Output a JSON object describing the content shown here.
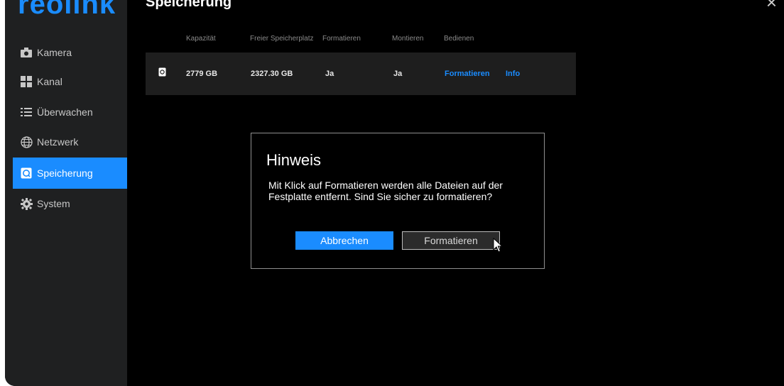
{
  "app": {
    "logo": "reolink"
  },
  "header": {
    "title": "Speicherung",
    "close_glyph": "×"
  },
  "sidebar": {
    "items": [
      {
        "label": "Kamera",
        "icon": "camera-icon",
        "active": false
      },
      {
        "label": "Kanal",
        "icon": "grid-icon",
        "active": false
      },
      {
        "label": "Überwachen",
        "icon": "list-icon",
        "active": false
      },
      {
        "label": "Netzwerk",
        "icon": "globe-icon",
        "active": false
      },
      {
        "label": "Speicherung",
        "icon": "storage-icon",
        "active": true
      },
      {
        "label": "System",
        "icon": "gear-icon",
        "active": false
      }
    ]
  },
  "table": {
    "headers": [
      "Kapazität",
      "Freier Speicherplatz",
      "Formatieren",
      "Montieren",
      "Bedienen"
    ],
    "rows": [
      {
        "capacity": "2779 GB",
        "free": "2327.30 GB",
        "format": "Ja",
        "mount": "Ja",
        "actions": [
          "Formatieren",
          "Info"
        ]
      }
    ]
  },
  "dialog": {
    "title": "Hinweis",
    "message": "Mit Klick auf Formatieren werden alle Dateien auf der Festplatte entfernt. Sind Sie sicher zu formatieren?",
    "cancel_label": "Abbrechen",
    "confirm_label": "Formatieren"
  },
  "colors": {
    "accent": "#1a8cff",
    "sidebar": "#1f2021",
    "background": "#000000"
  }
}
